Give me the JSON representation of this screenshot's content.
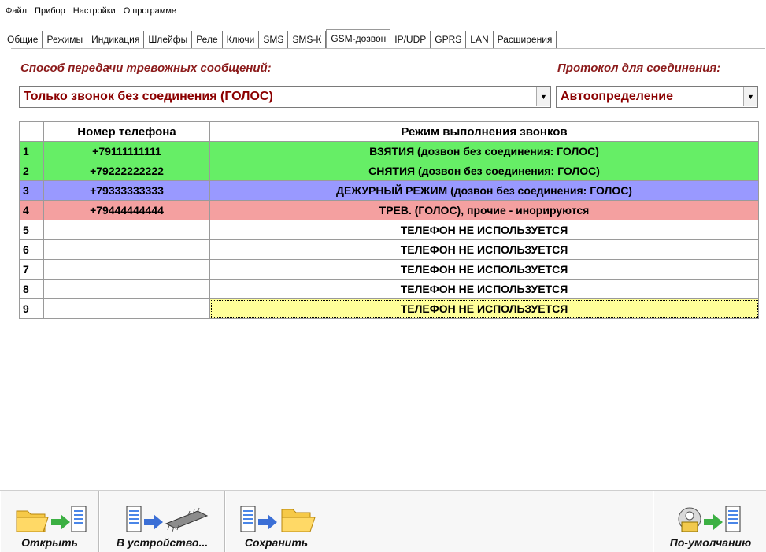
{
  "menu": [
    "Файл",
    "Прибор",
    "Настройки",
    "О программе"
  ],
  "tabs": [
    "Общие",
    "Режимы",
    "Индикация",
    "Шлейфы",
    "Реле",
    "Ключи",
    "SMS",
    "SMS-К",
    "GSM-дозвон",
    "IP/UDP",
    "GPRS",
    "LAN",
    "Расширения"
  ],
  "active_tab": "GSM-дозвон",
  "method_label": "Способ передачи тревожных сообщений:",
  "method_value": "Только звонок без соединения (ГОЛОС)",
  "protocol_label": "Протокол для соединения:",
  "protocol_value": "Автоопределение",
  "table": {
    "headers": [
      "",
      "Номер телефона",
      "Режим выполнения звонков"
    ],
    "rows": [
      {
        "num": "1",
        "phone": "+79111111111",
        "mode": "ВЗЯТИЯ (дозвон без соединения: ГОЛОС)",
        "color": "#66ee66"
      },
      {
        "num": "2",
        "phone": "+79222222222",
        "mode": "СНЯТИЯ (дозвон без соединения: ГОЛОС)",
        "color": "#66ee66"
      },
      {
        "num": "3",
        "phone": "+79333333333",
        "mode": "ДЕЖУРНЫЙ РЕЖИМ (дозвон без соединения: ГОЛОС)",
        "color": "#9999ff"
      },
      {
        "num": "4",
        "phone": "+79444444444",
        "mode": "ТРЕВ. (ГОЛОС), прочие - инорируются",
        "color": "#f4a0a0"
      },
      {
        "num": "5",
        "phone": "",
        "mode": "ТЕЛЕФОН НЕ ИСПОЛЬЗУЕТСЯ",
        "color": "#ffffff"
      },
      {
        "num": "6",
        "phone": "",
        "mode": "ТЕЛЕФОН НЕ ИСПОЛЬЗУЕТСЯ",
        "color": "#ffffff"
      },
      {
        "num": "7",
        "phone": "",
        "mode": "ТЕЛЕФОН НЕ ИСПОЛЬЗУЕТСЯ",
        "color": "#ffffff"
      },
      {
        "num": "8",
        "phone": "",
        "mode": "ТЕЛЕФОН НЕ ИСПОЛЬЗУЕТСЯ",
        "color": "#ffffff"
      },
      {
        "num": "9",
        "phone": "",
        "mode": "ТЕЛЕФОН НЕ ИСПОЛЬЗУЕТСЯ",
        "color": "#ffffff"
      }
    ]
  },
  "toolbar": {
    "open": "Открыть",
    "to_device": "В устройство...",
    "save": "Сохранить",
    "defaults": "По-умолчанию"
  },
  "icons": {
    "open": "folder-to-document-icon",
    "to_device": "document-to-chip-icon",
    "save": "document-to-folder-icon",
    "defaults": "device-to-document-icon"
  }
}
